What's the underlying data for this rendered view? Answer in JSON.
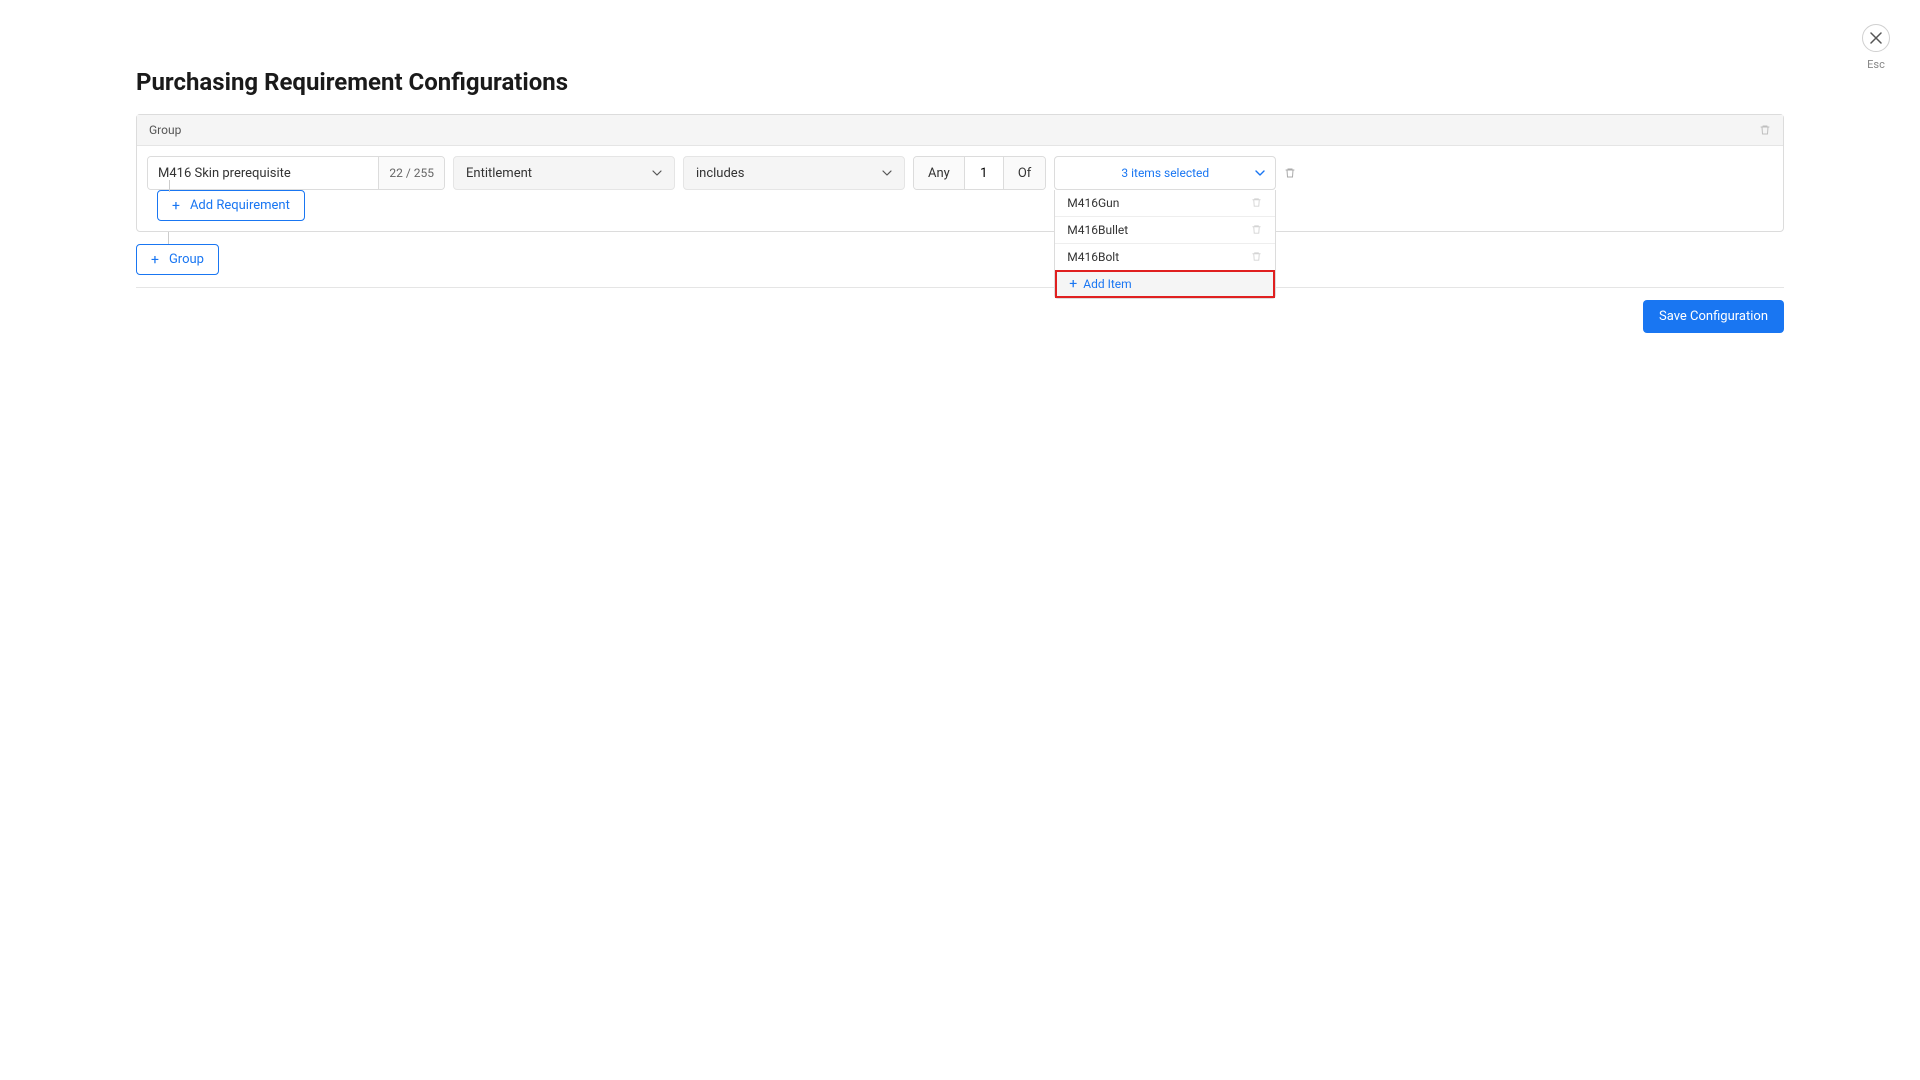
{
  "close": {
    "esc": "Esc"
  },
  "page": {
    "title": "Purchasing Requirement Configurations"
  },
  "group": {
    "label": "Group",
    "requirement": {
      "name": "M416 Skin prerequisite",
      "charCount": "22 / 255",
      "type": "Entitlement",
      "operator": "includes",
      "any": "Any",
      "qty": "1",
      "of": "Of",
      "selectedLabel": "3 items selected",
      "items": [
        "M416Gun",
        "M416Bullet",
        "M416Bolt"
      ],
      "addItem": "Add Item"
    },
    "addRequirement": "Add Requirement"
  },
  "addGroup": "Group",
  "save": "Save Configuration"
}
